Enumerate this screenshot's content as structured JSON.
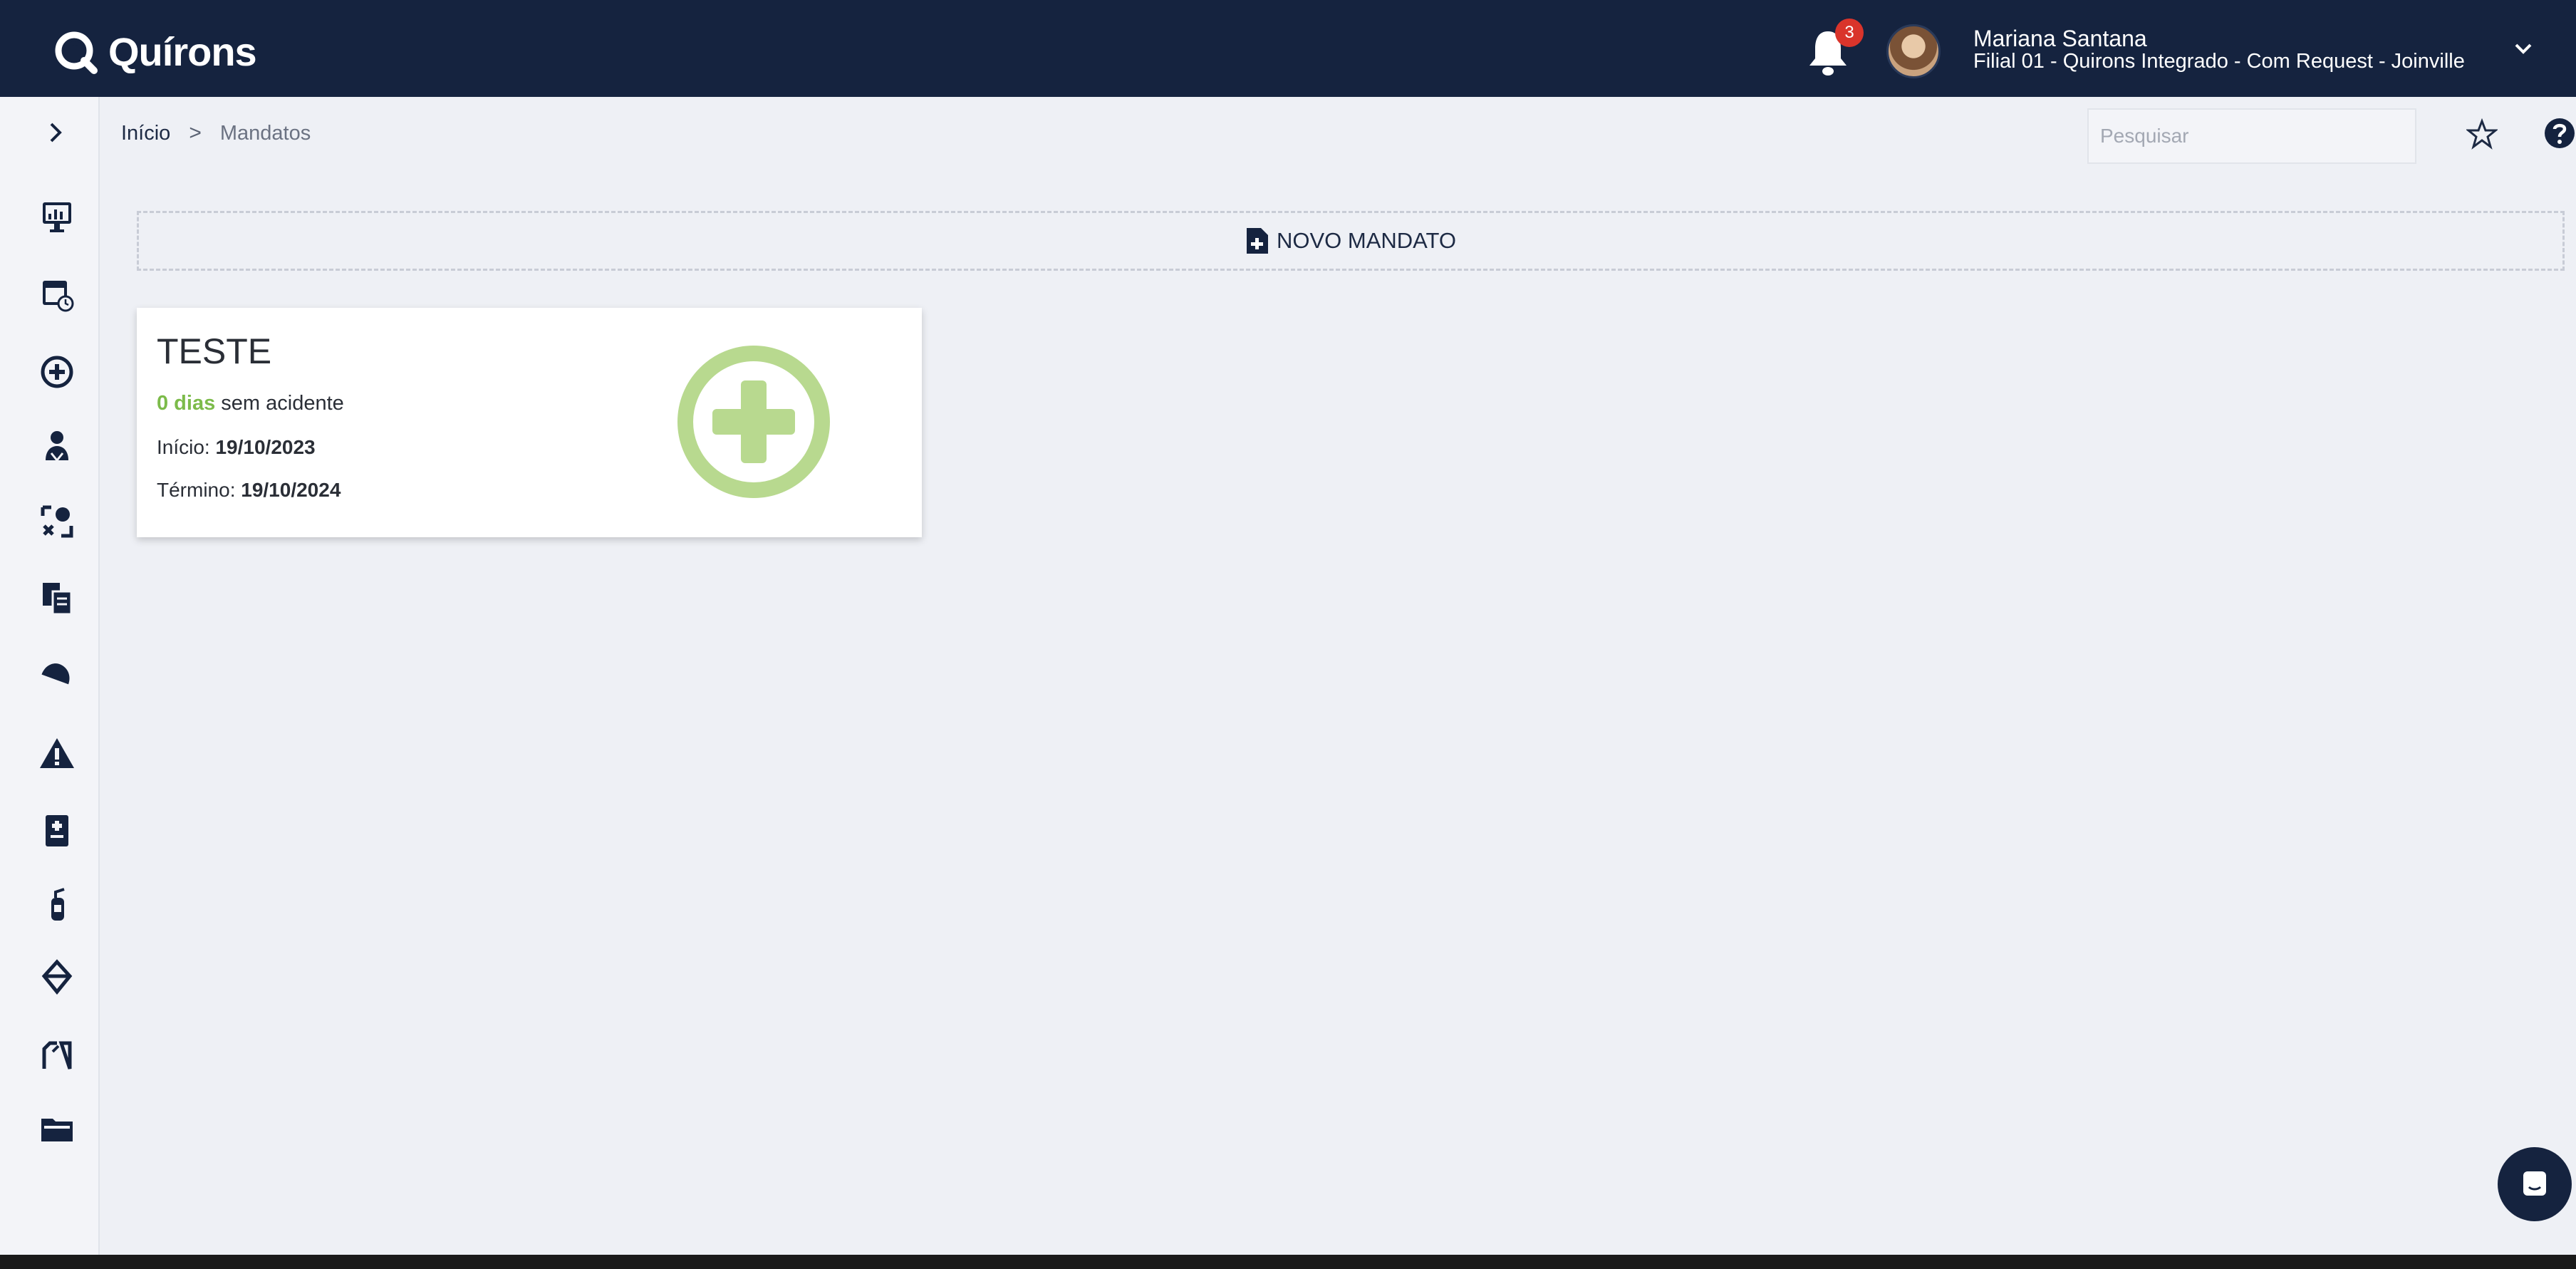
{
  "app": {
    "name": "Quírons",
    "notifications_count": "3",
    "user_name": "Mariana Santana",
    "user_branch": "Filial 01 - Quirons Integrado - Com Request - Joinville"
  },
  "breadcrumb": {
    "home": "Início",
    "separator": ">",
    "current": "Mandatos"
  },
  "search": {
    "placeholder": "Pesquisar"
  },
  "actions": {
    "new_mandate": "NOVO MANDATO"
  },
  "mandates": [
    {
      "title": "TESTE",
      "days_value": "0 dias",
      "days_suffix": "sem acidente",
      "start_label": "Início:",
      "start_date": "19/10/2023",
      "end_label": "Término:",
      "end_date": "19/10/2024"
    }
  ],
  "sidebar_icons": [
    "dashboard-icon",
    "calendar-clock-icon",
    "plus-circle-icon",
    "users-icon",
    "puzzle-icon",
    "documents-icon",
    "helmet-icon",
    "warning-icon",
    "medical-record-icon",
    "fire-extinguisher-icon",
    "safety-hat-icon",
    "folder-open-icon",
    "folder-icon"
  ],
  "colors": {
    "topbar": "#15233f",
    "accent_green": "#7cbb4a",
    "badge_red": "#d9342b"
  }
}
